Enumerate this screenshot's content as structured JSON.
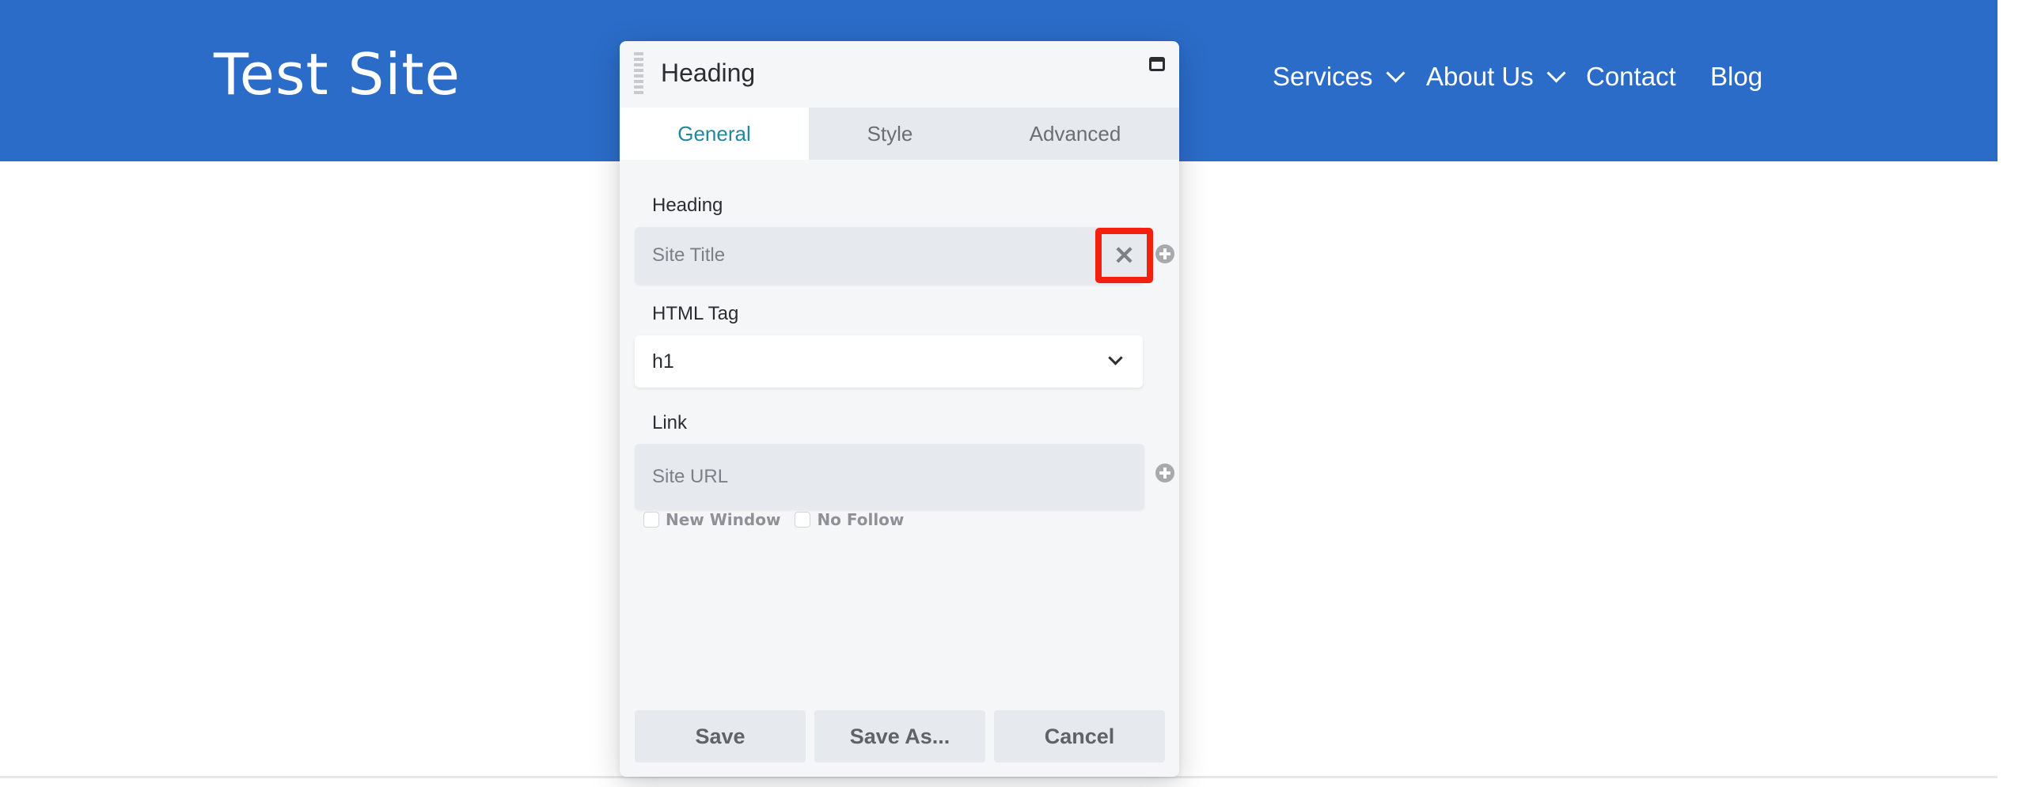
{
  "site": {
    "title": "Test Site",
    "header_color": "#2b6cc8",
    "nav": [
      {
        "label": "Services",
        "has_dropdown": true
      },
      {
        "label": "About Us",
        "has_dropdown": true
      },
      {
        "label": "Contact",
        "has_dropdown": false
      },
      {
        "label": "Blog",
        "has_dropdown": false
      }
    ]
  },
  "dialog": {
    "title": "Heading",
    "tabs": [
      {
        "label": "General",
        "active": true
      },
      {
        "label": "Style",
        "active": false
      },
      {
        "label": "Advanced",
        "active": false
      }
    ],
    "fields": {
      "heading": {
        "label": "Heading",
        "value": "Site Title",
        "connection_clear_icon": "close-icon",
        "highlight_color": "#f51f10"
      },
      "html_tag": {
        "label": "HTML Tag",
        "selected": "h1"
      },
      "link": {
        "label": "Link",
        "value": "Site URL",
        "options": [
          {
            "label": "New Window",
            "checked": false
          },
          {
            "label": "No Follow",
            "checked": false
          }
        ]
      }
    },
    "buttons": {
      "save": "Save",
      "save_as": "Save As...",
      "cancel": "Cancel"
    },
    "accent_color": "#21889c"
  }
}
